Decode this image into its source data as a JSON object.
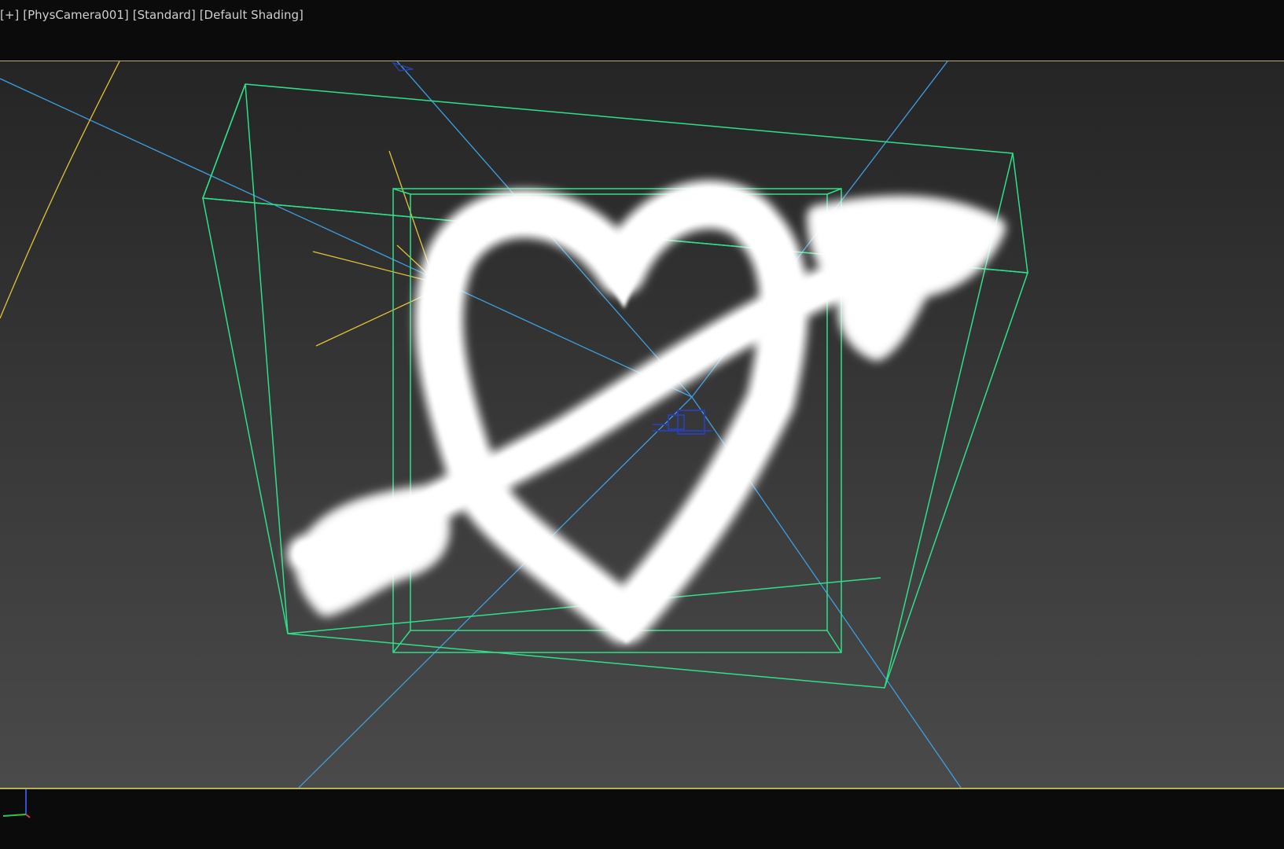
{
  "viewport_label": {
    "plus": "[+]",
    "camera": "[PhysCamera001]",
    "mode": "[Standard]",
    "shading": "[Default Shading]"
  },
  "colors": {
    "gizmo_green": "#2fe08a",
    "camera_line_blue": "#3f9fe0",
    "light_yellow": "#e3c23a",
    "viewport_border": "#b7b44a",
    "cloud": "#ffffff"
  },
  "icons": {
    "axis_tripod": "xyz-axis-icon",
    "camera_target": "camera-target-icon"
  }
}
